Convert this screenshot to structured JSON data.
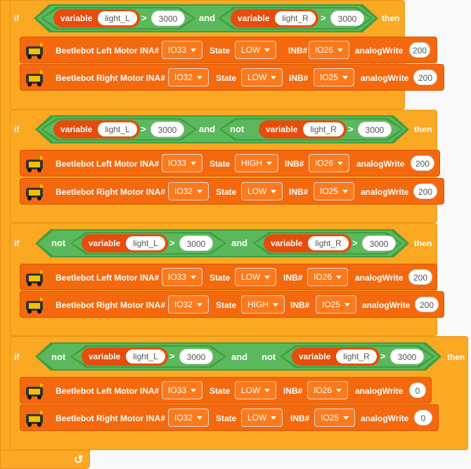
{
  "labels": {
    "if": "if",
    "then": "then",
    "and": "and",
    "not": "not",
    "variable": "variable",
    "gt": ">"
  },
  "motor_labels": {
    "left": "Beetlebot Left Motor INA#",
    "right": "Beetlebot Right Motor INA#",
    "state": "State",
    "inb": "INB#",
    "analog": "analogWrite"
  },
  "blocks": [
    {
      "cond": {
        "left": {
          "var": "light_L",
          "val": "3000"
        },
        "right": {
          "var": "light_R",
          "val": "3000"
        }
      },
      "left_motor": {
        "ina": "IO33",
        "state": "LOW",
        "inb": "IO26",
        "pwm": "200"
      },
      "right_motor": {
        "ina": "IO32",
        "state": "LOW",
        "inb": "IO25",
        "pwm": "200"
      }
    },
    {
      "cond": {
        "left": {
          "var": "light_L",
          "val": "3000"
        },
        "right": {
          "var": "light_R",
          "val": "3000"
        }
      },
      "left_motor": {
        "ina": "IO33",
        "state": "HIGH",
        "inb": "IO26",
        "pwm": "200"
      },
      "right_motor": {
        "ina": "IO32",
        "state": "LOW",
        "inb": "IO25",
        "pwm": "200"
      }
    },
    {
      "cond": {
        "left": {
          "var": "light_L",
          "val": "3000"
        },
        "right": {
          "var": "light_R",
          "val": "3000"
        }
      },
      "left_motor": {
        "ina": "IO33",
        "state": "LOW",
        "inb": "IO26",
        "pwm": "200"
      },
      "right_motor": {
        "ina": "IO32",
        "state": "HIGH",
        "inb": "IO25",
        "pwm": "200"
      }
    },
    {
      "cond": {
        "left": {
          "var": "light_L",
          "val": "3000"
        },
        "right": {
          "var": "light_R",
          "val": "3000"
        }
      },
      "left_motor": {
        "ina": "IO33",
        "state": "LOW",
        "inb": "IO26",
        "pwm": "0"
      },
      "right_motor": {
        "ina": "IO32",
        "state": "LOW",
        "inb": "IO25",
        "pwm": "0"
      }
    }
  ],
  "icons": {
    "loop": "loop-arrow-icon",
    "robot": "beetlebot-icon"
  }
}
